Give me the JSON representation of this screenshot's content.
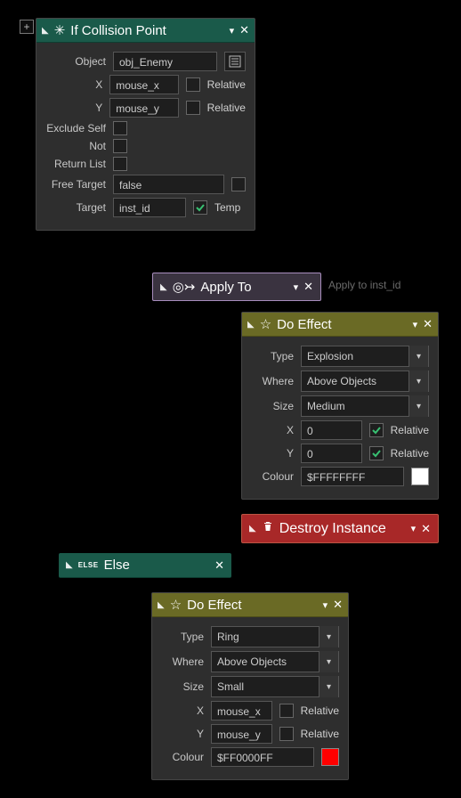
{
  "addIcon": "+",
  "collision": {
    "title": "If Collision Point",
    "rows": {
      "object_label": "Object",
      "object_value": "obj_Enemy",
      "x_label": "X",
      "x_value": "mouse_x",
      "relative_x": "Relative",
      "y_label": "Y",
      "y_value": "mouse_y",
      "relative_y": "Relative",
      "exclude_label": "Exclude Self",
      "not_label": "Not",
      "return_label": "Return List",
      "free_label": "Free Target",
      "free_value": "false",
      "target_label": "Target",
      "target_value": "inst_id",
      "temp_label": "Temp"
    }
  },
  "applyTo": {
    "title": "Apply To",
    "side": "Apply to inst_id"
  },
  "effect1": {
    "title": "Do Effect",
    "type_label": "Type",
    "type_value": "Explosion",
    "where_label": "Where",
    "where_value": "Above Objects",
    "size_label": "Size",
    "size_value": "Medium",
    "x_label": "X",
    "x_value": "0",
    "relative": "Relative",
    "y_label": "Y",
    "y_value": "0",
    "colour_label": "Colour",
    "colour_value": "$FFFFFFFF",
    "swatch": "#ffffff"
  },
  "destroy": {
    "title": "Destroy Instance"
  },
  "elseNode": {
    "title": "Else",
    "badge": "ELSE"
  },
  "effect2": {
    "title": "Do Effect",
    "type_label": "Type",
    "type_value": "Ring",
    "where_label": "Where",
    "where_value": "Above Objects",
    "size_label": "Size",
    "size_value": "Small",
    "x_label": "X",
    "x_value": "mouse_x",
    "relative": "Relative",
    "y_label": "Y",
    "y_value": "mouse_y",
    "colour_label": "Colour",
    "colour_value": "$FF0000FF",
    "swatch": "#ff0000"
  }
}
